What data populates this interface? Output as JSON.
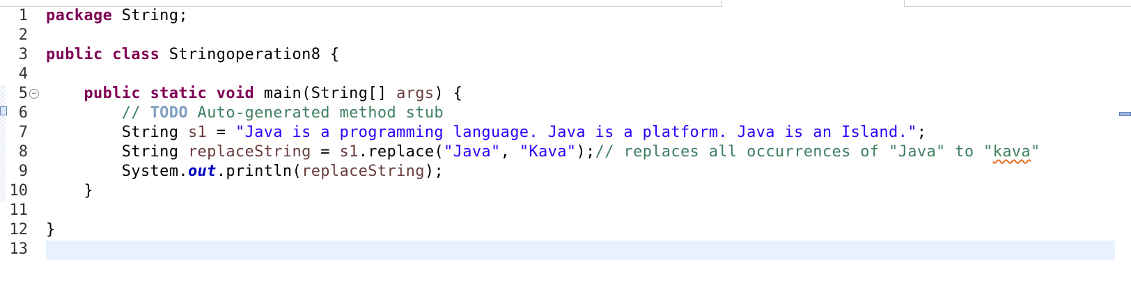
{
  "editor": {
    "lines": [
      {
        "n": "1",
        "tokens": [
          {
            "t": "package",
            "c": "kw"
          },
          {
            "t": " String;",
            "c": ""
          }
        ]
      },
      {
        "n": "2",
        "tokens": []
      },
      {
        "n": "3",
        "tokens": [
          {
            "t": "public",
            "c": "kw"
          },
          {
            "t": " ",
            "c": ""
          },
          {
            "t": "class",
            "c": "kw"
          },
          {
            "t": " Stringoperation8 {",
            "c": ""
          }
        ]
      },
      {
        "n": "4",
        "tokens": []
      },
      {
        "n": "5",
        "fold": true,
        "tokens": [
          {
            "t": "    ",
            "c": ""
          },
          {
            "t": "public",
            "c": "kw"
          },
          {
            "t": " ",
            "c": ""
          },
          {
            "t": "static",
            "c": "kw"
          },
          {
            "t": " ",
            "c": ""
          },
          {
            "t": "void",
            "c": "kw"
          },
          {
            "t": " main(String[] ",
            "c": ""
          },
          {
            "t": "args",
            "c": "var"
          },
          {
            "t": ") {",
            "c": ""
          }
        ]
      },
      {
        "n": "6",
        "tokens": [
          {
            "t": "        ",
            "c": ""
          },
          {
            "t": "// ",
            "c": "cm"
          },
          {
            "t": "TODO",
            "c": "todo"
          },
          {
            "t": " Auto-generated method stub",
            "c": "cm"
          }
        ]
      },
      {
        "n": "7",
        "tokens": [
          {
            "t": "        String ",
            "c": ""
          },
          {
            "t": "s1",
            "c": "var"
          },
          {
            "t": " = ",
            "c": ""
          },
          {
            "t": "\"Java is a programming language. Java is a platform. Java is an Island.\"",
            "c": "str"
          },
          {
            "t": ";",
            "c": ""
          }
        ]
      },
      {
        "n": "8",
        "tokens": [
          {
            "t": "        String ",
            "c": ""
          },
          {
            "t": "replaceString",
            "c": "var"
          },
          {
            "t": " = ",
            "c": ""
          },
          {
            "t": "s1",
            "c": "var"
          },
          {
            "t": ".replace(",
            "c": ""
          },
          {
            "t": "\"Java\"",
            "c": "str"
          },
          {
            "t": ", ",
            "c": ""
          },
          {
            "t": "\"Kava\"",
            "c": "str"
          },
          {
            "t": ");",
            "c": ""
          },
          {
            "t": "// replaces all occurrences of \"Java\" to \"",
            "c": "cm"
          },
          {
            "t": "kava",
            "c": "cm spell"
          },
          {
            "t": "\"",
            "c": "cm"
          }
        ]
      },
      {
        "n": "9",
        "tokens": [
          {
            "t": "        System.",
            "c": ""
          },
          {
            "t": "out",
            "c": "fld"
          },
          {
            "t": ".println(",
            "c": ""
          },
          {
            "t": "replaceString",
            "c": "var"
          },
          {
            "t": ");",
            "c": ""
          }
        ]
      },
      {
        "n": "10",
        "tokens": [
          {
            "t": "    }",
            "c": ""
          }
        ]
      },
      {
        "n": "11",
        "tokens": []
      },
      {
        "n": "12",
        "tokens": [
          {
            "t": "}",
            "c": ""
          }
        ]
      },
      {
        "n": "13",
        "tokens": []
      }
    ]
  },
  "icons": {
    "fold": "collapse-minus-icon",
    "task": "task-marker-icon",
    "overview": "overview-ruler-marker-icon"
  },
  "colors": {
    "keyword": "#7f0055",
    "string": "#2a00ff",
    "comment": "#3f7f5f",
    "todo": "#7f9fbf",
    "local_variable": "#6a3e3e",
    "static_field": "#0000c0",
    "current_line": "#e8f2fe",
    "spelling": "#e8732a"
  }
}
